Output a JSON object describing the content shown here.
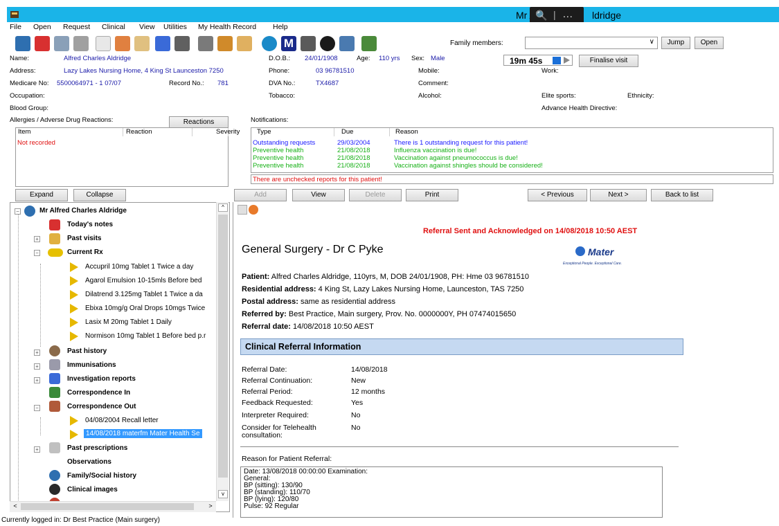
{
  "window": {
    "title": "Mr Alfred Charles Aldridge",
    "title_left": "Mr Alfre",
    "title_right": "ldridge"
  },
  "zoom_overlay": {
    "zoom_glyph": "🔍",
    "separator": "|",
    "more": "..."
  },
  "menu": [
    "File",
    "Open",
    "Request",
    "Clinical",
    "View",
    "Utilities",
    "My Health Record",
    "Help"
  ],
  "family": {
    "label": "Family members:",
    "jump": "Jump",
    "open": "Open"
  },
  "patient": {
    "name_label": "Name:",
    "name": "Alfred Charles Aldridge",
    "address_label": "Address:",
    "address": "Lazy Lakes Nursing Home, 4 King St  Launceston  7250",
    "medicare_label": "Medicare No:",
    "medicare": "5500064971 - 1  07/07",
    "record_label": "Record No.:",
    "record": "781",
    "occupation_label": "Occupation:",
    "blood_label": "Blood Group:",
    "dob_label": "D.O.B.:",
    "dob": "24/01/1908",
    "age_label": "Age:",
    "age": "110 yrs",
    "sex_label": "Sex:",
    "sex": "Male",
    "phone_label": "Phone:",
    "phone": "03 96781510",
    "dva_label": "DVA No.:",
    "dva": "TX4687",
    "tobacco_label": "Tobacco:",
    "mobile_label": "Mobile:",
    "comment_label": "Comment:",
    "alcohol_label": "Alcohol:",
    "work_label": "Work:",
    "elite_label": "Elite sports:",
    "ethnicity_label": "Ethnicity:",
    "ahd_label": "Advance Health Directive:"
  },
  "timer": {
    "value": "19m 45s",
    "finalise": "Finalise visit"
  },
  "allergies": {
    "label": "Allergies / Adverse Drug Reactions:",
    "reactions_button": "Reactions",
    "columns": [
      "Item",
      "Reaction",
      "Severity"
    ],
    "empty": "Not recorded"
  },
  "notifications": {
    "label": "Notifications:",
    "columns": [
      "Type",
      "Due",
      "Reason"
    ],
    "rows": [
      {
        "type": "Outstanding requests",
        "due": "29/03/2004",
        "reason": "There is 1 outstanding request for this patient!",
        "color": "#1a1aff"
      },
      {
        "type": "Preventive health",
        "due": "21/08/2018",
        "reason": "Influenza vaccination is due!",
        "color": "#16b016"
      },
      {
        "type": "Preventive health",
        "due": "21/08/2018",
        "reason": "Vaccination against pneumococcus is due!",
        "color": "#16b016"
      },
      {
        "type": "Preventive health",
        "due": "21/08/2018",
        "reason": "Vaccination against shingles should be considered!",
        "color": "#16b016"
      }
    ],
    "unchecked": "There are unchecked reports for this patient!"
  },
  "actions": {
    "expand": "Expand",
    "collapse": "Collapse",
    "add": "Add",
    "view": "View",
    "delete": "Delete",
    "print": "Print",
    "previous": "< Previous",
    "next": "Next >",
    "back": "Back to list"
  },
  "tree": {
    "root": "Mr Alfred Charles Aldridge",
    "todays_notes": "Today's notes",
    "past_visits": "Past visits",
    "current_rx": "Current Rx",
    "rx": [
      "Accupril 10mg Tablet 1 Twice a day",
      "Agarol Emulsion 10-15mls Before bed",
      "Dilatrend 3.125mg Tablet 1 Twice a da",
      "Ebixa 10mg/g Oral Drops 10mgs Twice",
      "Lasix M 20mg Tablet 1 Daily",
      "Normison 10mg Tablet 1 Before bed p.r"
    ],
    "past_history": "Past history",
    "immunisations": "Immunisations",
    "investigation": "Investigation reports",
    "corr_in": "Correspondence In",
    "corr_out": "Correspondence Out",
    "out_items": [
      "04/08/2004   Recall letter",
      "14/08/2018  materfm  Mater Health Se"
    ],
    "past_prescriptions": "Past prescriptions",
    "observations": "Observations",
    "family_social": "Family/Social history",
    "clinical_images": "Clinical images"
  },
  "document": {
    "banner": "Referral Sent and Acknowledged on 14/08/2018 10:50 AEST",
    "heading": "General Surgery - Dr C Pyke",
    "logo_name": "Mater",
    "logo_tagline": "Exceptional People. Exceptional Care.",
    "patient_label": "Patient:",
    "patient_text": "Alfred Charles Aldridge, 110yrs, M, DOB 24/01/1908, PH: Hme 03 96781510",
    "res_label": "Residential address:",
    "res_text": "4 King St, Lazy Lakes Nursing Home, Launceston, TAS 7250",
    "postal_label": "Postal address:",
    "postal_text": "same as residential address",
    "refby_label": "Referred by:",
    "refby_text": "Best Practice, Main surgery, Prov. No. 0000000Y, PH 07474015650",
    "refdate_label": "Referral date:",
    "refdate_text": "14/08/2018 10:50 AEST",
    "section_title": "Clinical Referral Information",
    "fields": [
      {
        "label": "Referral Date:",
        "value": "14/08/2018"
      },
      {
        "label": "Referral Continuation:",
        "value": "New"
      },
      {
        "label": "Referral Period:",
        "value": "12 months"
      },
      {
        "label": "Feedback Requested:",
        "value": "Yes"
      },
      {
        "label": "Interpreter Required:",
        "value": "No"
      },
      {
        "label": "Consider for Telehealth",
        "value": "No"
      }
    ],
    "telehealth_cont": "consultation:",
    "reason_label": "Reason for Patient Referral:",
    "reason_lines": [
      "Date: 13/08/2018 00:00:00 Examination:",
      "General:",
      "BP (sitting): 130/90",
      "BP (standing): 110/70",
      "BP (lying): 120/80",
      "Pulse: 92 Regular"
    ]
  },
  "status": "Currently logged in:  Dr Best Practice (Main surgery)"
}
